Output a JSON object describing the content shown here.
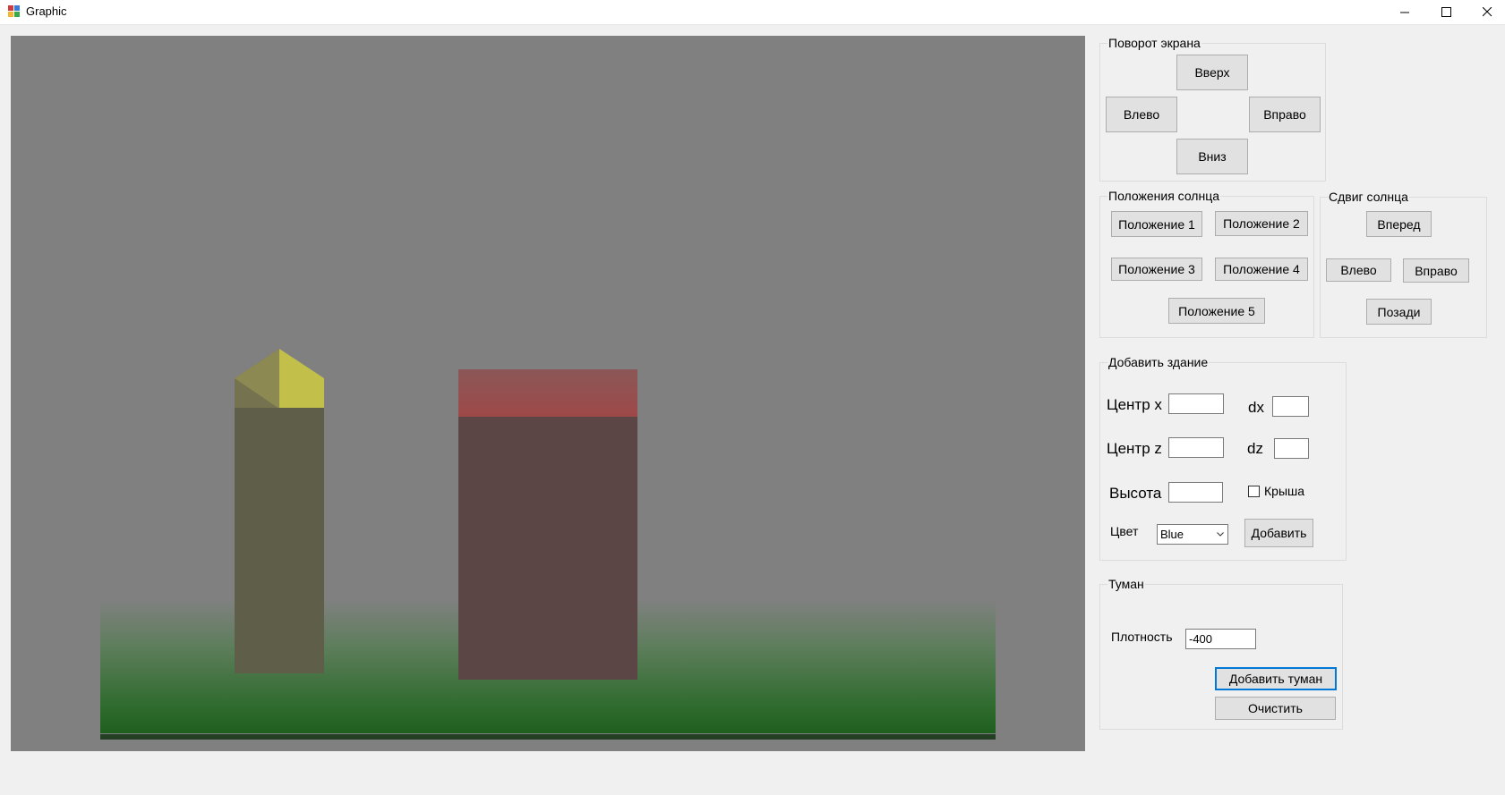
{
  "window": {
    "title": "Graphic",
    "minimize": "—",
    "maximize": "☐",
    "close": "✕"
  },
  "rotation": {
    "title": "Поворот экрана",
    "up": "Вверх",
    "left": "Влево",
    "right": "Вправо",
    "down": "Вниз"
  },
  "sun_positions": {
    "title": "Положения солнца",
    "pos1": "Положение 1",
    "pos2": "Положение 2",
    "pos3": "Положение 3",
    "pos4": "Положение 4",
    "pos5": "Положение 5"
  },
  "sun_shift": {
    "title": "Сдвиг солнца",
    "forward": "Вперед",
    "left": "Влево",
    "right": "Вправо",
    "back": "Позади"
  },
  "add_building": {
    "title": "Добавить здание",
    "center_x_label": "Центр x",
    "center_x_value": "",
    "dx_label": "dx",
    "dx_value": "",
    "center_z_label": "Центр z",
    "center_z_value": "",
    "dz_label": "dz",
    "dz_value": "",
    "height_label": "Высота",
    "height_value": "",
    "roof_label": "Крыша",
    "roof_checked": false,
    "color_label": "Цвет",
    "color_value": "Blue",
    "add_button": "Добавить"
  },
  "fog": {
    "title": "Туман",
    "density_label": "Плотность",
    "density_value": "-400",
    "add_button": "Добавить туман",
    "clear_button": "Очистить"
  },
  "colors": {
    "sky": "#808080",
    "grass": "#1f5f1e",
    "tower_body": "#5f5e49",
    "tower_roof_light": "#c2c04a",
    "house_body": "#5c4545",
    "house_roof": "#9e4848",
    "focus": "#0078d7"
  }
}
